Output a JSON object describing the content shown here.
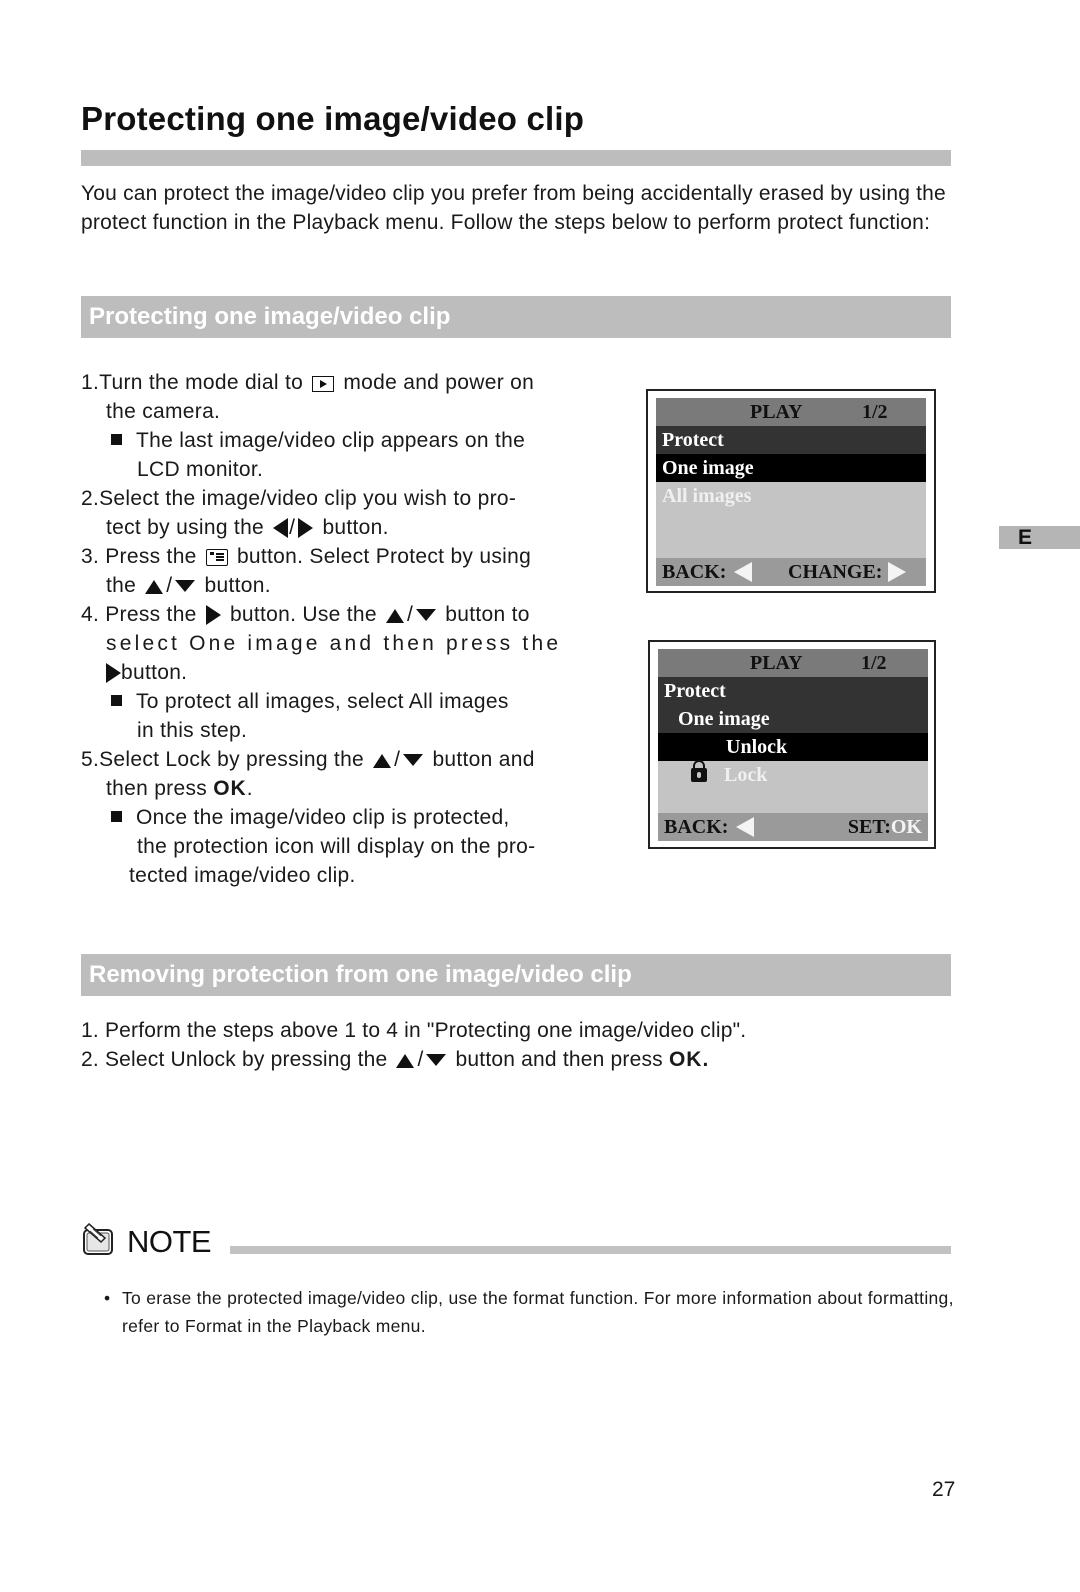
{
  "page": {
    "title": "Protecting one image/video clip",
    "intro": "You can protect the image/video clip you prefer from being accidentally erased by using the protect function in the Playback menu. Follow the steps below to perform protect function:",
    "side_tab": "E",
    "page_number": "27"
  },
  "section_protect": {
    "heading": "Protecting one image/video clip",
    "steps": {
      "s1a": "1.Turn the mode dial to",
      "s1b": "mode and  power on",
      "s1c": "the camera.",
      "s1n1": "The last image/video clip appears on the",
      "s1n2": "LCD monitor.",
      "s2a": "2.Select the image/video clip you wish to pro-",
      "s2b": "tect by using the",
      "s2c": "button.",
      "s3a": "3. Press the",
      "s3b": "button. Select Protect by using",
      "s3c": "the",
      "s3d": "button.",
      "s4a": "4. Press the",
      "s4b": "button. Use the",
      "s4c": "button to",
      "s4d": "select  One  image  and  then  press  the",
      "s4e": "button.",
      "s4n1": "To protect all images, select All images",
      "s4n2": "in this step.",
      "s5a": "5.Select Lock by pressing the",
      "s5b": "button and",
      "s5c": "then press",
      "s5ok": "OK",
      "s5d": ".",
      "s5n1": "Once the image/video clip is protected,",
      "s5n2": "the protection icon will display on the pro-",
      "s5n3": "tected image/video clip.",
      "slash": "/"
    }
  },
  "lcd1": {
    "header_title": "PLAY",
    "header_page": "1/2",
    "rows": [
      "Protect",
      "One image",
      "All images"
    ],
    "back_label": "BACK:",
    "change_label": "CHANGE:"
  },
  "lcd2": {
    "header_title": "PLAY",
    "header_page": "1/2",
    "rows": [
      "Protect",
      "One image",
      "Unlock",
      "Lock"
    ],
    "back_label": "BACK:",
    "set_label": "SET:",
    "set_value": "OK"
  },
  "section_remove": {
    "heading": "Removing protection from one image/video clip",
    "step1": "1. Perform the steps above 1 to 4 in \"Protecting one image/video clip\".",
    "step2a": "2. Select Unlock by pressing the",
    "slash": "/",
    "step2b": "button and then press",
    "step2ok": "OK."
  },
  "note": {
    "label": "NOTE",
    "bullet": "•",
    "text": "To erase the protected image/video clip, use the format function. For more information about formatting, refer to Format in the Playback menu."
  }
}
